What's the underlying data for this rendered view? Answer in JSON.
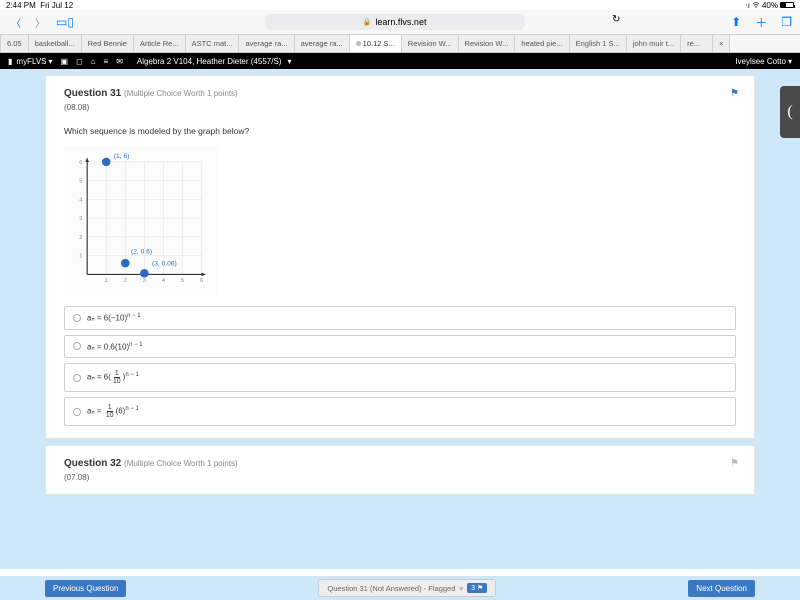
{
  "status": {
    "time": "2:44 PM",
    "date": "Fri Jul 12",
    "battery_pct": "40%"
  },
  "browser": {
    "url_host": "learn.flvs.net",
    "tabs": [
      "6.05",
      "basketball...",
      "Red Bennie",
      "Article Re...",
      "ASTC mat...",
      "average ra...",
      "average ra...",
      "10.12 S...",
      "Revision W...",
      "Revision W...",
      "heated pie...",
      "English 1 S...",
      "john muir t...",
      "re..."
    ],
    "active_tab_index": 7
  },
  "app": {
    "brand": "myFLVS",
    "course": "Algebra 2 V104, Heather Dieter (4557/S)",
    "user": "Iveylsee Cotto"
  },
  "q31": {
    "title": "Question 31",
    "meta": "(Multiple Choice Worth 1 points)",
    "code": "(08.08)",
    "prompt": "Which sequence is modeled by the graph below?"
  },
  "chart_data": {
    "type": "scatter",
    "title": "",
    "xlabel": "",
    "ylabel": "",
    "xlim": [
      0,
      6
    ],
    "ylim": [
      0,
      6
    ],
    "xticks": [
      1,
      2,
      3,
      4,
      5,
      6
    ],
    "yticks": [
      1,
      2,
      3,
      4,
      5,
      6
    ],
    "points": [
      {
        "x": 1,
        "y": 6,
        "label": "(1, 6)"
      },
      {
        "x": 2,
        "y": 0.6,
        "label": "(2, 0.6)"
      },
      {
        "x": 3,
        "y": 0.06,
        "label": "(3, 0.06)"
      }
    ]
  },
  "options": {
    "a_prefix": "aₙ = 6(−10)",
    "a_suffix": "n − 1",
    "b_prefix": "aₙ = 0.6(10)",
    "b_suffix": "n − 1",
    "c_prefix": "aₙ = 6(",
    "c_frac_n": "1",
    "c_frac_d": "10",
    "c_mid": ")",
    "c_suffix": "n − 1",
    "d_prefix": "aₙ = ",
    "d_frac_n": "1",
    "d_frac_d": "10",
    "d_mid": "(6)",
    "d_suffix": "n − 1"
  },
  "q32": {
    "title": "Question 32",
    "meta": "(Multiple Choice Worth 1 points)",
    "code": "(07.08)"
  },
  "footer": {
    "prev": "Previous Question",
    "next": "Next Question",
    "status": "Question 31 (Not Answered) - Flagged",
    "count": "3"
  }
}
